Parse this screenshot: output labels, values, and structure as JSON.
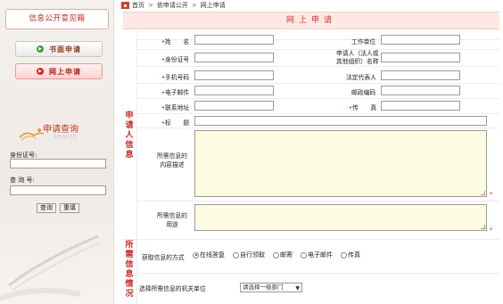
{
  "sidebar": {
    "title": "信息公开意见箱",
    "buttons": [
      {
        "label": "书面申请"
      },
      {
        "label": "网上申请"
      }
    ],
    "query": {
      "title": "申请查询",
      "subtitle": "search",
      "id_label": "身份证号:",
      "query_label": "查 询 号:",
      "query_button": "查询",
      "reset_button": "重填"
    }
  },
  "breadcrumb": [
    "首页",
    "依申请公开",
    "网上申请"
  ],
  "page_title": "网上申请",
  "groups": {
    "applicant": [
      "申",
      "请",
      "人",
      "信",
      "息"
    ],
    "requested": [
      "所",
      "需",
      "信",
      "息",
      "情",
      "况"
    ]
  },
  "form": {
    "name": {
      "required": "•",
      "label": "姓　　名"
    },
    "work_unit": {
      "label": "工作单位"
    },
    "id_number": {
      "required": "•",
      "label": "身份证号"
    },
    "applicant_org": {
      "label_line1": "申请人（法人或",
      "label_line2": "其他组织）名称"
    },
    "mobile": {
      "required": "•",
      "label": "手机号码"
    },
    "legal_rep": {
      "label": "法定代表人"
    },
    "email": {
      "required": "•",
      "label": "电子邮件"
    },
    "postcode": {
      "label": "邮政编码"
    },
    "address": {
      "required": "•",
      "label": "联系地址"
    },
    "fax": {
      "required": "•",
      "label": "传　　真"
    },
    "subject": {
      "required": "•",
      "label": "标　　题"
    },
    "content_desc": {
      "label_line1": "所需信息的",
      "label_line2": "内容描述"
    },
    "purpose": {
      "label_line1": "所需信息的",
      "label_line2": "用途"
    },
    "delivery": {
      "label": "获取信息的方式",
      "options": [
        "在线答复",
        "自行领取",
        "邮寄",
        "电子邮件",
        "传真"
      ],
      "selected": "在线答复"
    },
    "department": {
      "label": "选择所需信息的机关单位",
      "selected": "请选择一级部门"
    }
  }
}
